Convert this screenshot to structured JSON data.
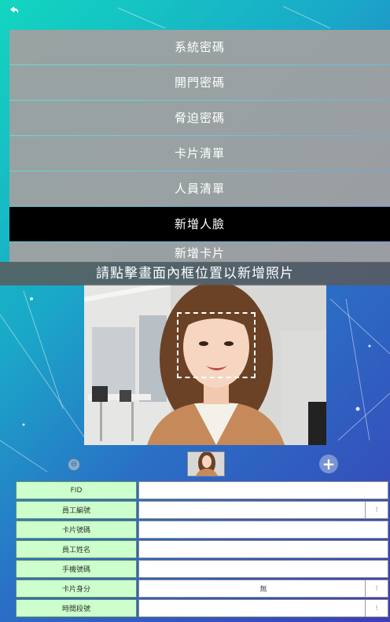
{
  "menu": {
    "items": [
      {
        "label": "系統密碼"
      },
      {
        "label": "開門密碼"
      },
      {
        "label": "脅迫密碼"
      },
      {
        "label": "卡片清單"
      },
      {
        "label": "人員清單"
      },
      {
        "label": "新增人臉"
      },
      {
        "label": "新增卡片"
      }
    ],
    "active_index": 5
  },
  "instruction": "請點擊畫面內框位置以新增照片",
  "form": {
    "rows": [
      {
        "label": "FID",
        "value": "",
        "spinner": false
      },
      {
        "label": "員工編號",
        "value": "",
        "spinner": true
      },
      {
        "label": "卡片號碼",
        "value": "",
        "spinner": false
      },
      {
        "label": "員工姓名",
        "value": "",
        "spinner": false
      },
      {
        "label": "手機號碼",
        "value": "",
        "spinner": false
      },
      {
        "label": "卡片身分",
        "value": "無",
        "spinner": true
      },
      {
        "label": "時間段號",
        "value": "",
        "spinner": true
      }
    ]
  },
  "colors": {
    "menu_item_bg": "#a0a0a0",
    "menu_active_bg": "#000000",
    "label_bg": "#ccffcc",
    "bg_start": "#12d6c0",
    "bg_end": "#3b3fb5"
  },
  "icons": {
    "back": "back-arrow-icon",
    "remove": "remove-circle-icon",
    "add": "plus-circle-icon"
  }
}
